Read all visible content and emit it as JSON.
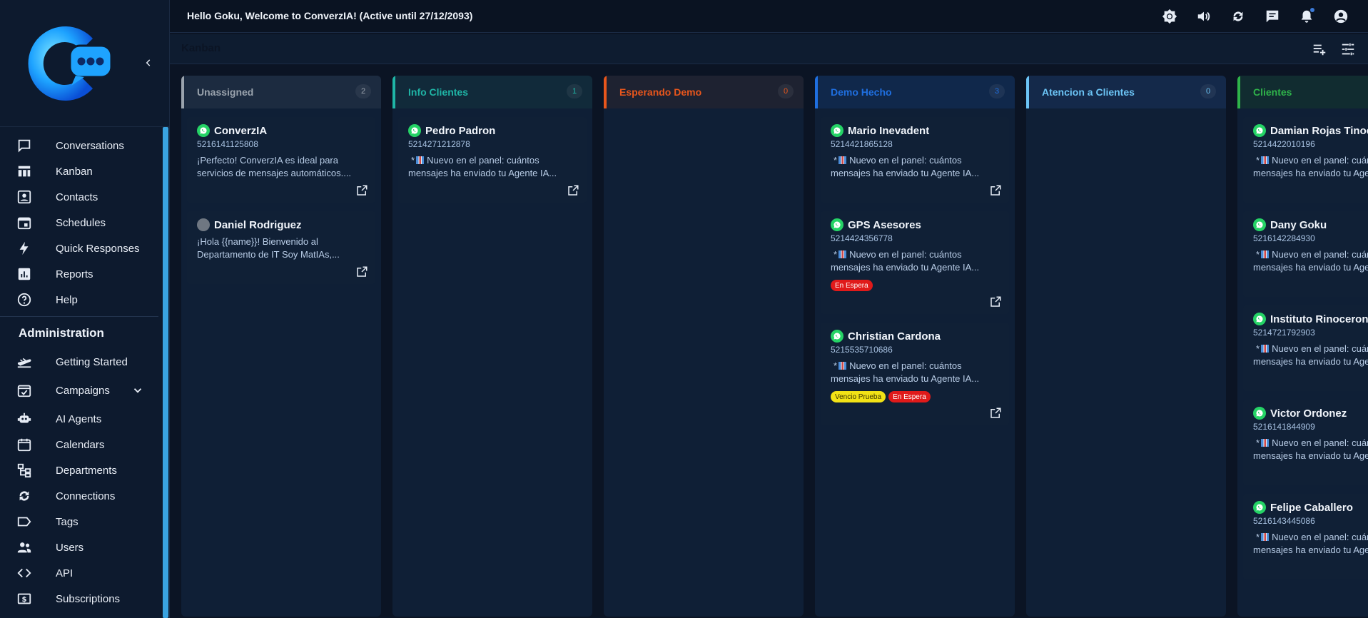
{
  "topbar": {
    "greeting": "Hello Goku, Welcome to ConverzIA! (Active until 27/12/2093)",
    "icons": [
      "brightness-icon",
      "volume-icon",
      "sync-icon",
      "chat-icon",
      "bell-icon",
      "account-icon"
    ]
  },
  "subheader": {
    "title": "Kanban"
  },
  "sidebar": {
    "items": [
      {
        "label": "Conversations",
        "icon": "chat-bubble-icon"
      },
      {
        "label": "Kanban",
        "icon": "kanban-icon"
      },
      {
        "label": "Contacts",
        "icon": "contacts-icon"
      },
      {
        "label": "Schedules",
        "icon": "schedule-icon"
      },
      {
        "label": "Quick Responses",
        "icon": "bolt-icon"
      },
      {
        "label": "Reports",
        "icon": "reports-icon"
      },
      {
        "label": "Help",
        "icon": "help-icon"
      }
    ],
    "section": "Administration",
    "admin_items": [
      {
        "label": "Getting Started",
        "icon": "plane-icon"
      },
      {
        "label": "Campaigns",
        "icon": "campaign-icon"
      },
      {
        "label": "AI Agents",
        "icon": "robot-icon"
      },
      {
        "label": "Calendars",
        "icon": "calendar-icon"
      },
      {
        "label": "Departments",
        "icon": "departments-icon"
      },
      {
        "label": "Connections",
        "icon": "connections-icon"
      },
      {
        "label": "Tags",
        "icon": "tag-icon"
      },
      {
        "label": "Users",
        "icon": "users-icon"
      },
      {
        "label": "API",
        "icon": "code-icon"
      },
      {
        "label": "Subscriptions",
        "icon": "dollar-icon"
      }
    ]
  },
  "colors": {
    "unassigned": "#9aa3ad",
    "info": "#1fb5a6",
    "demo": "#e8561c",
    "demo_hecho": "#1f6fe0",
    "atencion": "#6cc4f5",
    "clientes": "#2fb34a",
    "whatsapp": "#25d366",
    "tag_red": "#e01a1a",
    "tag_yellow": "#f2e216"
  },
  "lanes": [
    {
      "title": "Unassigned",
      "count": "2",
      "cards": [
        {
          "name": "ConverzIA",
          "phone": "5216141125808",
          "msg": "¡Perfecto! ConverzIA es ideal para servicios de mensajes automáticos....",
          "wa": true,
          "tags": []
        },
        {
          "name": "Daniel Rodriguez",
          "phone": "",
          "msg": "¡Hola {{name}}! Bienvenido al Departamento de IT Soy MatIAs,...",
          "wa": false,
          "tags": []
        }
      ]
    },
    {
      "title": "Info Clientes",
      "count": "1",
      "cards": [
        {
          "name": "Pedro Padron",
          "phone": "5214271212878",
          "msg": "Nuevo en el panel: cuántos mensajes ha enviado tu Agente IA...",
          "wa": true,
          "tags": []
        }
      ]
    },
    {
      "title": "Esperando Demo",
      "count": "0",
      "cards": []
    },
    {
      "title": "Demo Hecho",
      "count": "3",
      "cards": [
        {
          "name": "Mario Inevadent",
          "phone": "5214421865128",
          "msg": "Nuevo en el panel: cuántos mensajes ha enviado tu Agente IA...",
          "wa": true,
          "tags": []
        },
        {
          "name": "GPS Asesores",
          "phone": "5214424356778",
          "msg": "Nuevo en el panel: cuántos mensajes ha enviado tu Agente IA...",
          "wa": true,
          "tags": [
            "En Espera"
          ]
        },
        {
          "name": "Christian Cardona",
          "phone": "5215535710686",
          "msg": "Nuevo en el panel: cuántos mensajes ha enviado tu Agente IA...",
          "wa": true,
          "tags": [
            "Vencio Prueba",
            "En Espera"
          ]
        }
      ]
    },
    {
      "title": "Atencion a Clientes",
      "count": "0",
      "cards": []
    },
    {
      "title": "Clientes",
      "count": "",
      "cards": [
        {
          "name": "Damian Rojas Tinoco",
          "phone": "5214422010196",
          "msg": "Nuevo en el panel: cuántos mensajes ha enviado tu Agente IA...",
          "wa": true,
          "tags": []
        },
        {
          "name": "Dany Goku",
          "phone": "5216142284930",
          "msg": "Nuevo en el panel: cuántos mensajes ha enviado tu Agente IA...",
          "wa": true,
          "tags": []
        },
        {
          "name": "Instituto Rinoceronte",
          "phone": "5214721792903",
          "msg": "Nuevo en el panel: cuántos mensajes ha enviado tu Agente IA...",
          "wa": true,
          "tags": []
        },
        {
          "name": "Victor Ordonez",
          "phone": "5216141844909",
          "msg": "Nuevo en el panel: cuántos mensajes ha enviado tu Agente IA...",
          "wa": true,
          "tags": []
        },
        {
          "name": "Felipe Caballero",
          "phone": "5216143445086",
          "msg": "Nuevo en el panel: cuántos mensajes ha enviado tu Agente IA...",
          "wa": true,
          "tags": []
        }
      ]
    }
  ]
}
